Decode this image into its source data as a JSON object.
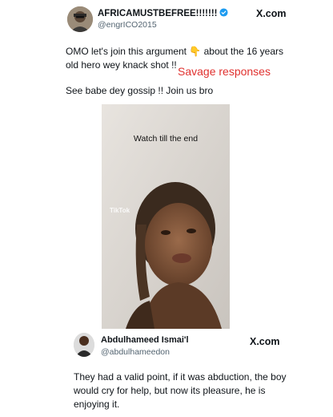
{
  "tweet1": {
    "display_name": "AFRICAMUSTBEFREE!!!!!!!",
    "handle": "@engrICO2015",
    "brand": "X.com",
    "text_line1": "OMO let's join this argument 👇 about the 16 years old hero wey knack shot !!",
    "text_line2": "See babe dey gossip !! Join us bro",
    "overlay_label": "Savage responses",
    "video_caption": "Watch till the end",
    "video_watermark": "TikTok"
  },
  "tweet2": {
    "display_name": "Abdulhameed Ismai'l",
    "handle": "@abdulhameedon",
    "brand": "X.com",
    "text": "They had a valid point, if it was abduction, the boy would cry for help, but now its pleasure, he is enjoying it."
  },
  "colors": {
    "verified_badge": "#1d9bf0",
    "overlay_red": "#e0312f",
    "handle_gray": "#536471"
  },
  "icons": {
    "verified": "verified-badge-icon",
    "avatar1": "user-avatar",
    "avatar2": "user-avatar"
  }
}
